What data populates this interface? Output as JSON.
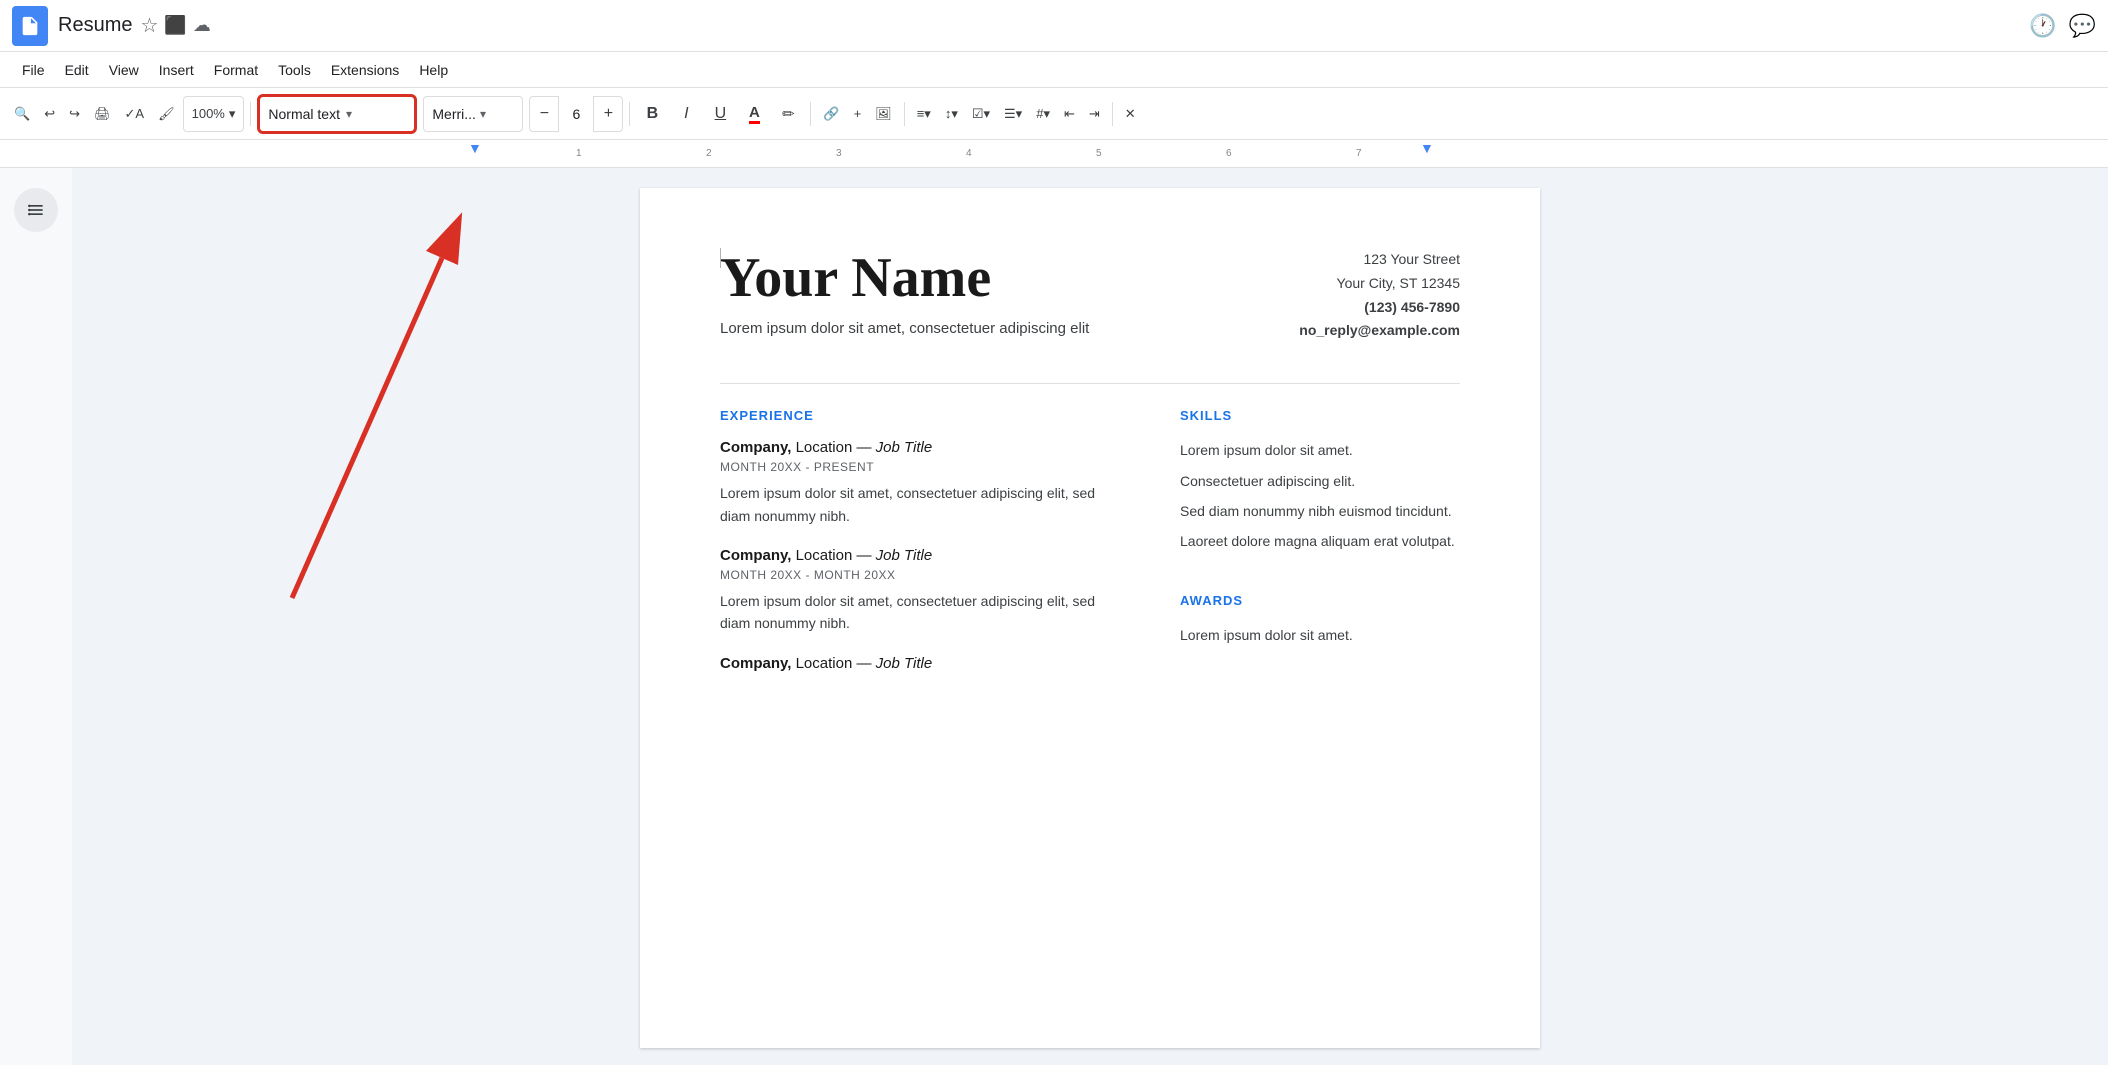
{
  "app": {
    "title": "Resume",
    "icon_color": "#4285f4"
  },
  "title_bar": {
    "doc_name": "Resume",
    "star_icon": "☆",
    "save_cloud_icon": "☁",
    "history_icon": "🕐",
    "chat_icon": "💬"
  },
  "menu": {
    "items": [
      "File",
      "Edit",
      "View",
      "Insert",
      "Format",
      "Tools",
      "Extensions",
      "Help"
    ]
  },
  "toolbar": {
    "zoom": "100%",
    "zoom_arrow": "▾",
    "format_style": "Normal text",
    "format_style_arrow": "▾",
    "font": "Merri...",
    "font_arrow": "▾",
    "font_size": "6",
    "bold": "B",
    "italic": "I",
    "underline": "U",
    "text_color": "A",
    "highlight": "✏",
    "link": "🔗",
    "insert_plus": "+",
    "insert_image": "🖼",
    "align": "≡",
    "line_spacing": "↕",
    "checklist": "☑",
    "bullet_list": "☰",
    "numbered_list": "#",
    "indent_decrease": "←",
    "indent_increase": "→",
    "clear_format": "✕"
  },
  "document": {
    "name": "Your Name",
    "subtitle": "Lorem ipsum dolor sit amet, consectetuer adipiscing elit",
    "contact": {
      "street": "123 Your Street",
      "city": "Your City, ST 12345",
      "phone": "(123) 456-7890",
      "email": "no_reply@example.com"
    },
    "sections": {
      "experience": {
        "title": "EXPERIENCE",
        "jobs": [
          {
            "company": "Company,",
            "location": " Location — ",
            "role": "Job Title",
            "date": "MONTH 20XX - PRESENT",
            "desc": "Lorem ipsum dolor sit amet, consectetuer adipiscing elit, sed diam nonummy nibh."
          },
          {
            "company": "Company,",
            "location": " Location — ",
            "role": "Job Title",
            "date": "MONTH 20XX - MONTH 20XX",
            "desc": "Lorem ipsum dolor sit amet, consectetuer adipiscing elit, sed diam nonummy nibh."
          },
          {
            "company": "Company,",
            "location": " Location — ",
            "role": "Job Title",
            "date": "",
            "desc": ""
          }
        ]
      },
      "skills": {
        "title": "SKILLS",
        "items": [
          "Lorem ipsum dolor sit amet.",
          "Consectetuer adipiscing elit.",
          "Sed diam nonummy nibh euismod tincidunt.",
          "Laoreet dolore magna aliquam erat volutpat."
        ]
      },
      "awards": {
        "title": "AWARDS",
        "items": [
          "Lorem ipsum dolor sit amet."
        ]
      }
    }
  },
  "annotation": {
    "arrow_color": "#d93025"
  }
}
